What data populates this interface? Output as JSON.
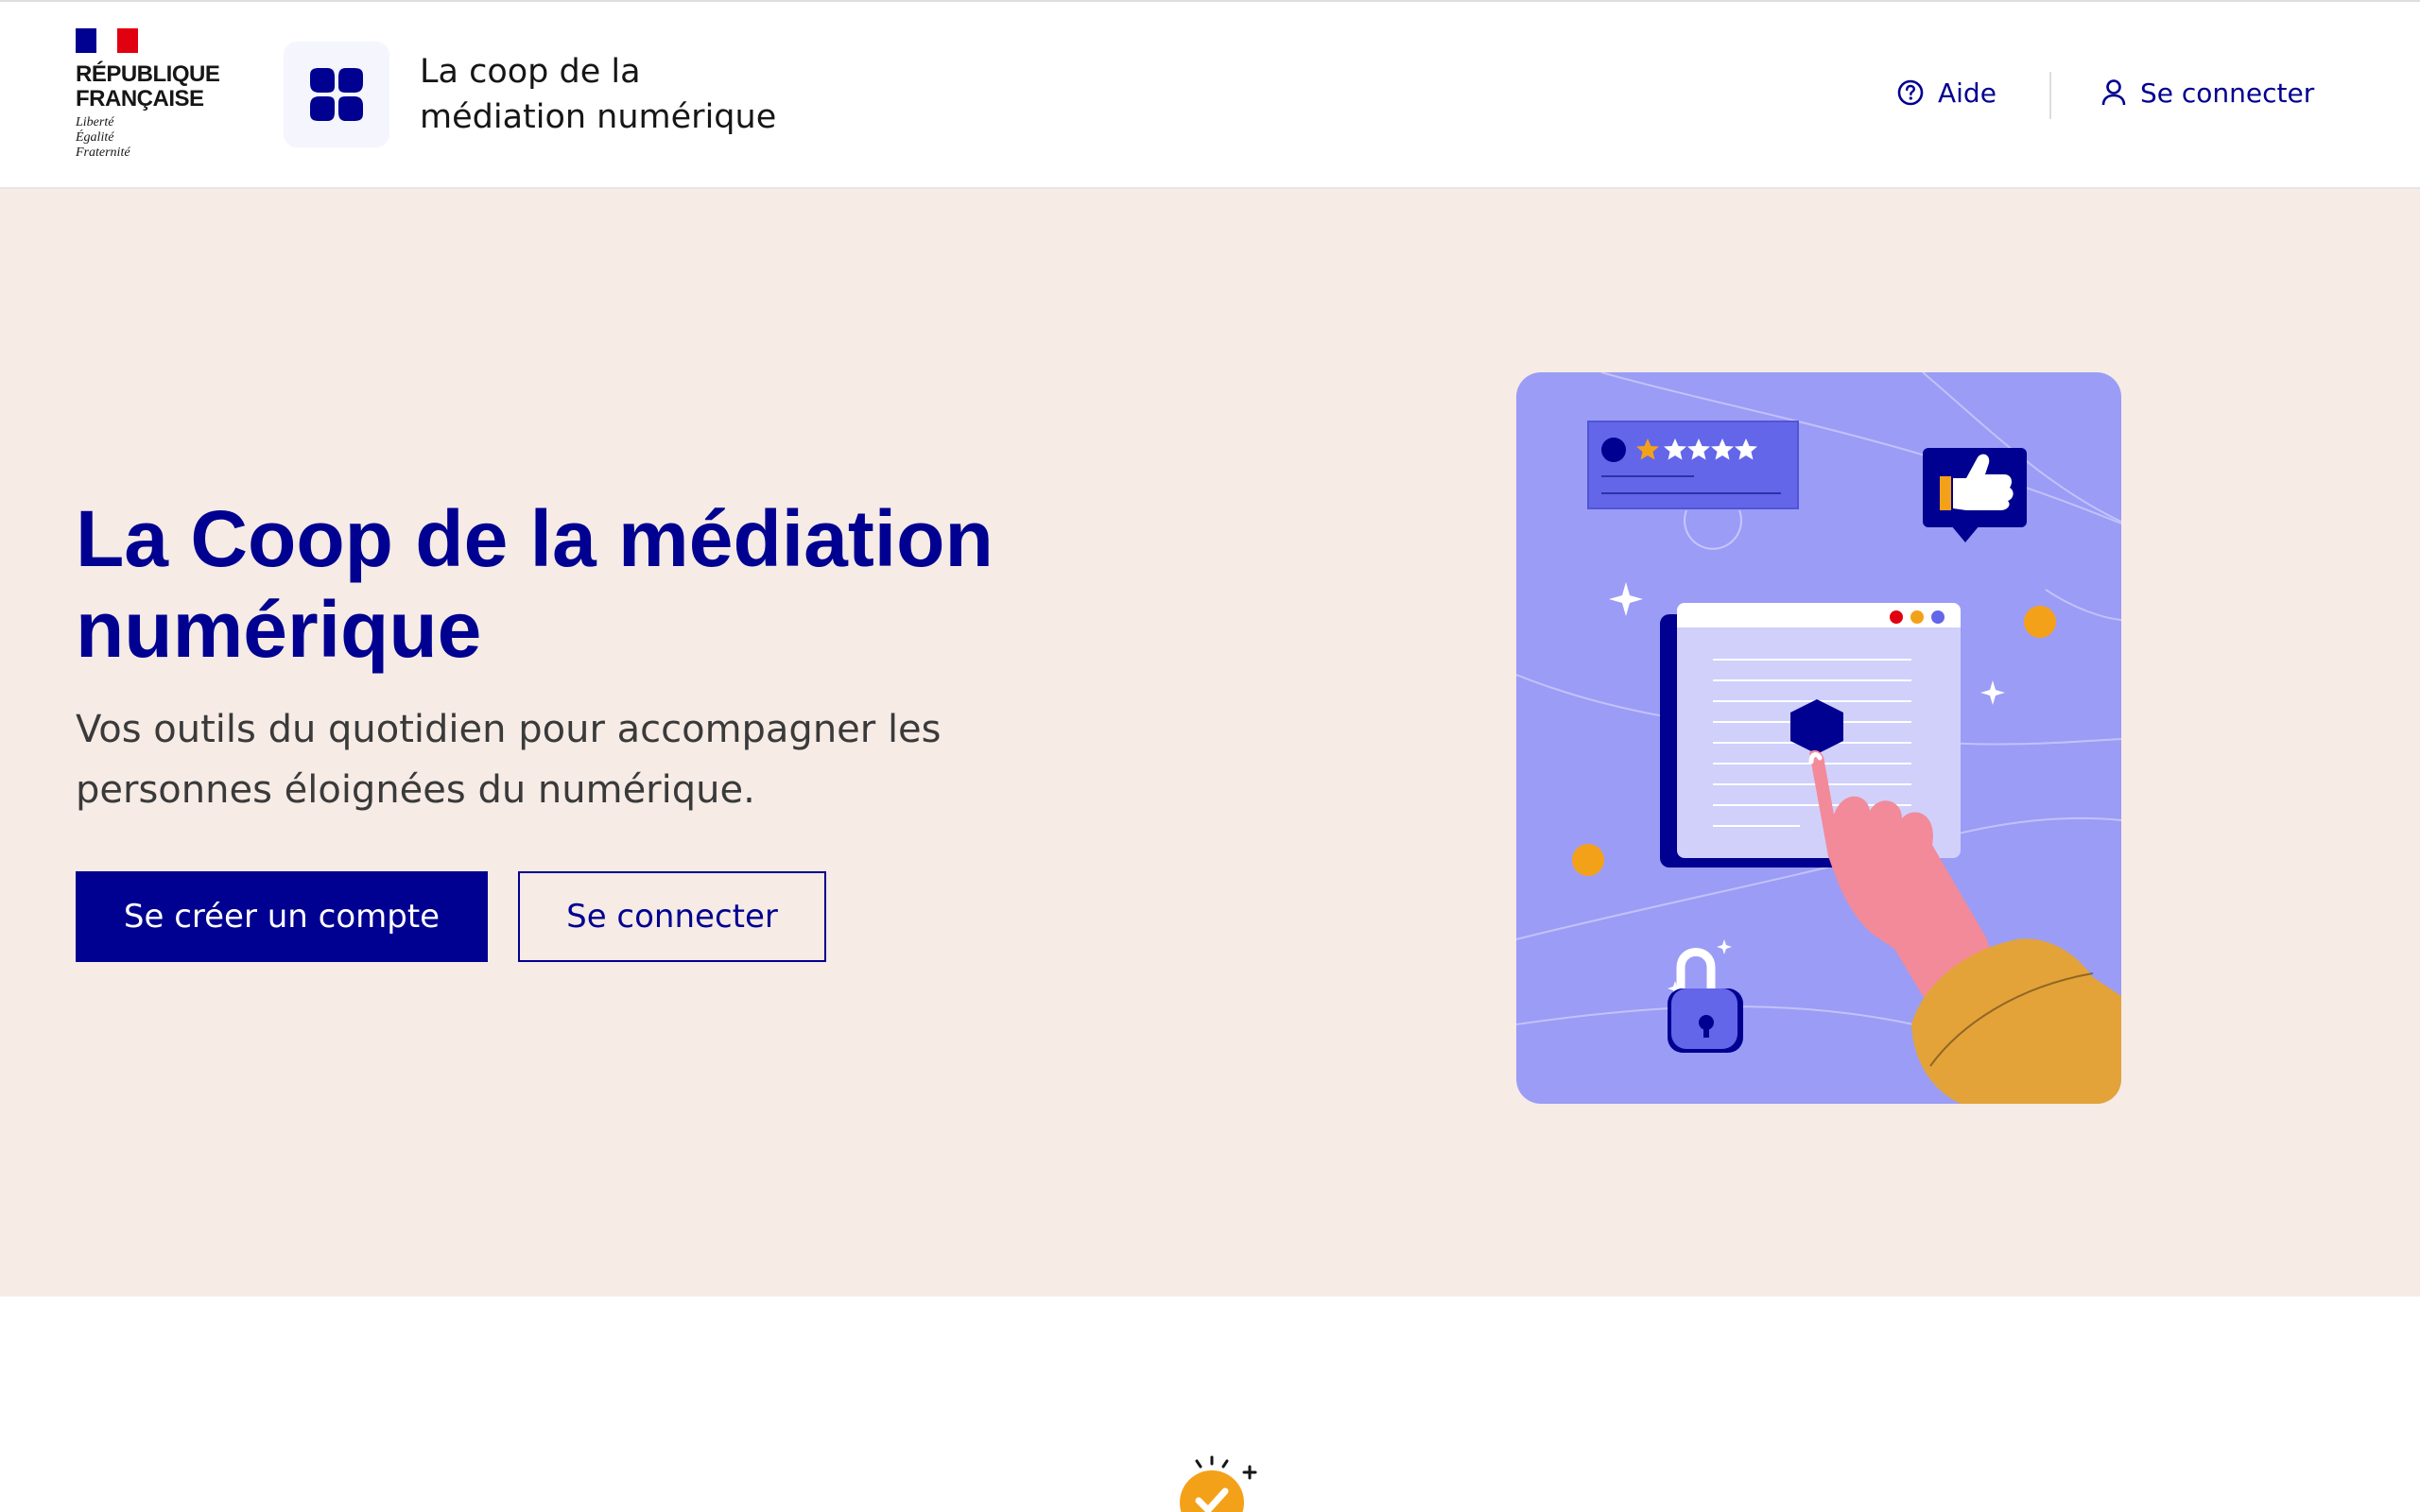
{
  "header": {
    "gov_logo": {
      "name_line1": "RÉPUBLIQUE",
      "name_line2": "FRANÇAISE",
      "motto": [
        "Liberté",
        "Égalité",
        "Fraternité"
      ]
    },
    "app_icon": "clover-icon",
    "app_title_line1": "La coop de la",
    "app_title_line2": "médiation numérique",
    "nav": {
      "help_label": "Aide",
      "help_icon": "question-circle-icon",
      "login_label": "Se connecter",
      "login_icon": "user-icon"
    }
  },
  "hero": {
    "title": "La Coop de la médiation numérique",
    "subtitle": "Vos outils du quotidien pour accompagner les personnes éloignées du numérique.",
    "primary_button": "Se créer un compte",
    "secondary_button": "Se connecter"
  },
  "colors": {
    "brand_blue": "#000091",
    "hero_background": "#f6ebe5",
    "illustration_background": "#9b9cf5",
    "accent_orange": "#f4a11a",
    "hand_pink": "#f28a9a"
  }
}
